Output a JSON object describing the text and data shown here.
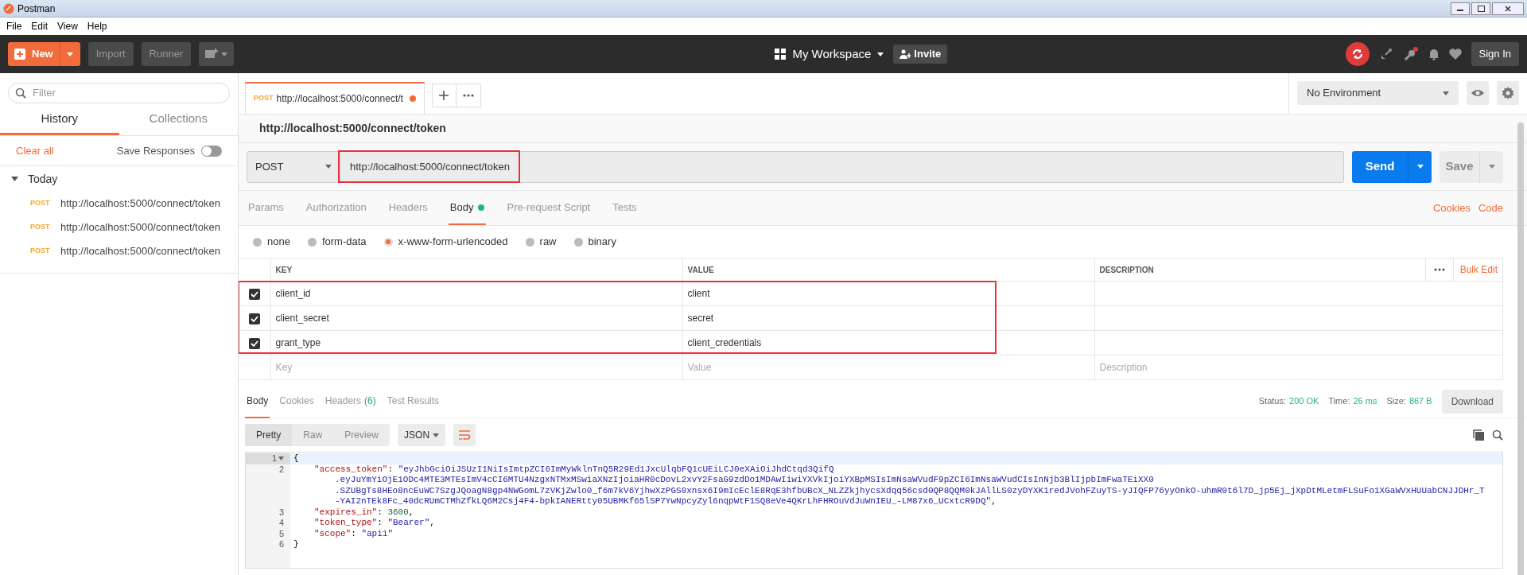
{
  "app_title": "Postman",
  "menu": [
    "File",
    "Edit",
    "View",
    "Help"
  ],
  "header": {
    "new_button": "New",
    "import_button": "Import",
    "runner_button": "Runner",
    "workspace": "My Workspace",
    "invite_button": "Invite",
    "sign_in_button": "Sign In"
  },
  "sidebar": {
    "filter_placeholder": "Filter",
    "tabs": [
      {
        "label": "History",
        "selected": true
      },
      {
        "label": "Collections",
        "selected": false
      }
    ],
    "clear_all": "Clear all",
    "save_responses": {
      "label": "Save Responses",
      "on": false
    },
    "group": {
      "label": "Today",
      "expanded": true,
      "items": [
        {
          "method": "POST",
          "url": "http://localhost:5000/connect/token"
        },
        {
          "method": "POST",
          "url": "http://localhost:5000/connect/token"
        },
        {
          "method": "POST",
          "url": "http://localhost:5000/connect/token"
        }
      ]
    }
  },
  "open_tabs": [
    {
      "method": "POST",
      "title": "http://localhost:5000/connect/t",
      "unsaved": true,
      "selected": true
    }
  ],
  "environment": "No Environment",
  "request": {
    "name": "http://localhost:5000/connect/token",
    "method": "POST",
    "url": "http://localhost:5000/connect/token",
    "send_button": "Send",
    "save_button": "Save"
  },
  "request_sections": [
    {
      "label": "Params",
      "selected": false,
      "indicator": false
    },
    {
      "label": "Authorization",
      "selected": false,
      "indicator": false
    },
    {
      "label": "Headers",
      "selected": false,
      "indicator": false
    },
    {
      "label": "Body",
      "selected": true,
      "indicator": true
    },
    {
      "label": "Pre-request Script",
      "selected": false,
      "indicator": false
    },
    {
      "label": "Tests",
      "selected": false,
      "indicator": false
    }
  ],
  "links": [
    "Cookies",
    "Code"
  ],
  "body_types": [
    {
      "label": "none",
      "selected": false
    },
    {
      "label": "form-data",
      "selected": false
    },
    {
      "label": "x-www-form-urlencoded",
      "selected": true
    },
    {
      "label": "raw",
      "selected": false
    },
    {
      "label": "binary",
      "selected": false
    }
  ],
  "params": {
    "columns": [
      "KEY",
      "VALUE",
      "DESCRIPTION"
    ],
    "bulk_edit": "Bulk Edit",
    "rows": [
      {
        "checked": true,
        "key": "client_id",
        "value": "client"
      },
      {
        "checked": true,
        "key": "client_secret",
        "value": "secret"
      },
      {
        "checked": true,
        "key": "grant_type",
        "value": "client_credentials"
      }
    ],
    "new_row": [
      {
        "placeholder": "Key"
      },
      {
        "placeholder": "Value"
      },
      {
        "placeholder": "Description"
      }
    ]
  },
  "response": {
    "tabs": [
      {
        "label": "Body",
        "selected": true
      },
      {
        "label": "Cookies",
        "selected": false
      },
      {
        "label": "Headers",
        "count": "(6)",
        "selected": false
      },
      {
        "label": "Test Results",
        "selected": false
      }
    ],
    "stats": [
      {
        "label": "Status:",
        "value": "200 OK"
      },
      {
        "label": "Time:",
        "value": "26 ms"
      },
      {
        "label": "Size:",
        "value": "867 B"
      }
    ],
    "download_button": "Download",
    "view_modes": [
      {
        "label": "Pretty",
        "selected": true
      },
      {
        "label": "Raw",
        "selected": false
      },
      {
        "label": "Preview",
        "selected": false
      }
    ],
    "format": "JSON",
    "code_lines": [
      {
        "number": "1",
        "segments": [
          {
            "kind": "punct",
            "text": "{"
          }
        ],
        "children": [
          {
            "number": "2",
            "segments": [
              {
                "kind": "key",
                "text": "\"access_token\""
              },
              {
                "kind": "punct",
                "text": ": "
              },
              {
                "kind": "string",
                "text": "\"eyJhbGciOiJSUzI1NiIsImtpZCI6ImMyWklnTnQ5R29Ed1JxcUlqbFQ1cUEiLCJ0eXAiOiJhdCtqd3QifQ"
              }
            ],
            "continuations": [
              [
                {
                  "kind": "string",
                  "text": ".eyJuYmYiOjE1ODc4MTE3MTEsImV4cCI6MTU4NzgxNTMxMSwiaXNzIjoiaHR0cDovL2xvY2FsaG9zdDo1MDAwIiwiYXVkIjoiYXBpMSIsImNsaWVudF9pZCI6ImNsaWVudCIsInNjb3BlIjpbImFwaTEiXX0"
                }
              ],
              [
                {
                  "kind": "string",
                  "text": ".SZUBgTs8HEo8ncEuWC7SzgJQoagN8gp4NWGomL7zVKjZwlo0_f6m7kV6YjhwXzPGS0xnsx6I9mIcEclE8RqE3hfbUBcX_NLZZkjhycsXdqq56csd0QP8QQM0kJAllLS0zyDYXK1redJVohFZuyTS-yJIQFP76yyOnkO-uhmR0t6l7D_jp5Ej_jXpDtMLetmFLSuFo1XGaWVxHUUabCNJJDHr_T"
                }
              ],
              [
                {
                  "kind": "string",
                  "text": "-YAI2nTEk8Fc_40dcRUmCTMhZfkLQ6M2Csj4F4-bpkIANERtty05UBMKf65lSP7YwNpcyZyl6nqpWtF1SQ8eVe4QKrLhFHROuVdJuWnIEU_-LM87x6_UCxtcR9DQ\""
                },
                {
                  "kind": "punct",
                  "text": ","
                }
              ]
            ]
          },
          {
            "number": "3",
            "segments": [
              {
                "kind": "key",
                "text": "\"expires_in\""
              },
              {
                "kind": "punct",
                "text": ": "
              },
              {
                "kind": "number",
                "text": "3600"
              },
              {
                "kind": "punct",
                "text": ","
              }
            ]
          },
          {
            "number": "4",
            "segments": [
              {
                "kind": "key",
                "text": "\"token_type\""
              },
              {
                "kind": "punct",
                "text": ": "
              },
              {
                "kind": "string",
                "text": "\"Bearer\""
              },
              {
                "kind": "punct",
                "text": ","
              }
            ]
          },
          {
            "number": "5",
            "segments": [
              {
                "kind": "key",
                "text": "\"scope\""
              },
              {
                "kind": "punct",
                "text": ": "
              },
              {
                "kind": "string",
                "text": "\"api1\""
              }
            ]
          }
        ]
      },
      {
        "number": "6",
        "segments": [
          {
            "kind": "punct",
            "text": "}"
          }
        ]
      }
    ]
  }
}
